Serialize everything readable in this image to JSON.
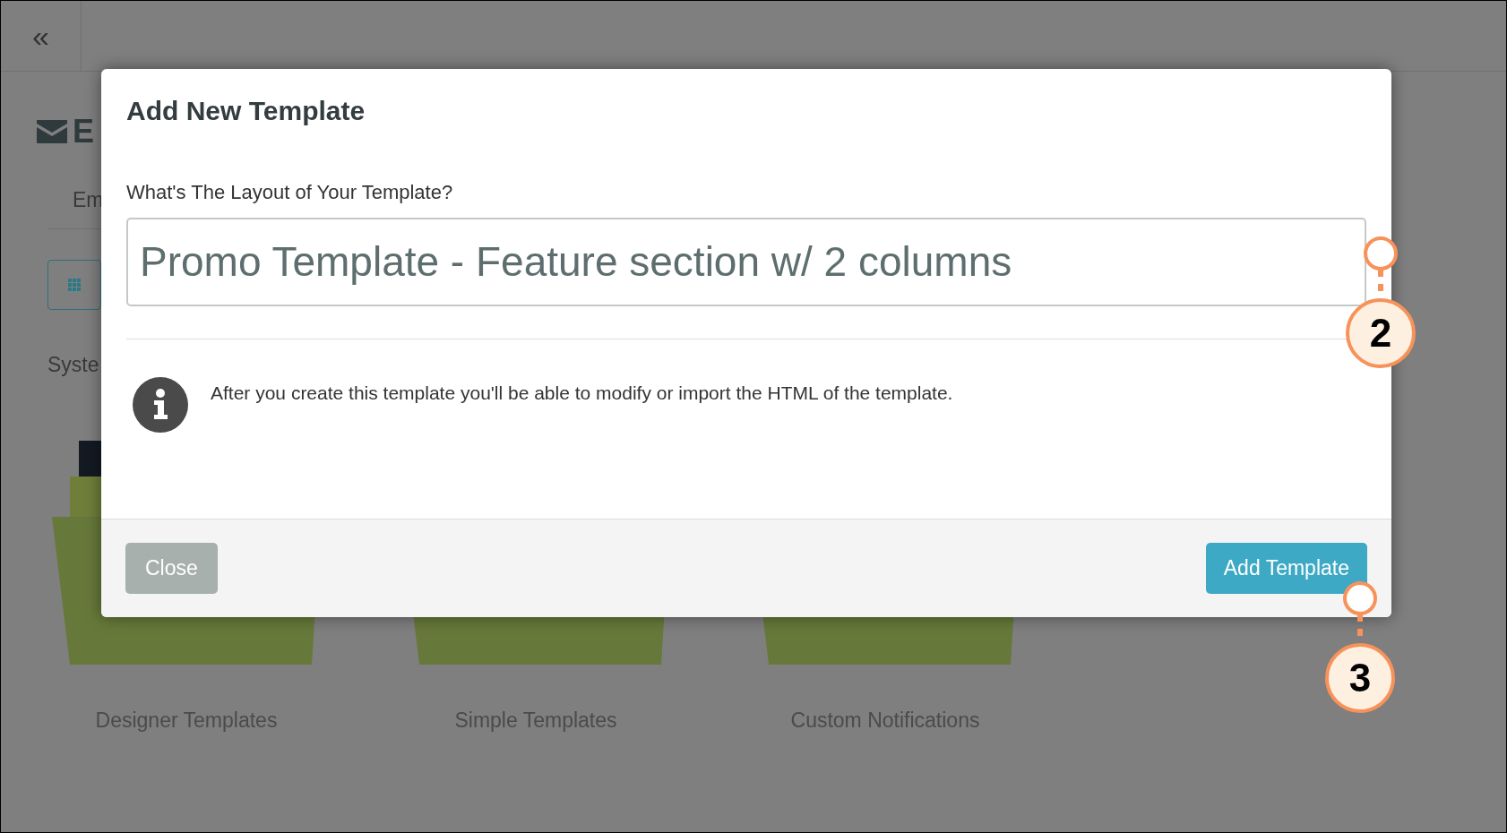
{
  "topbar": {
    "collapse_icon": "«"
  },
  "background": {
    "heading": "E",
    "tab": "Em",
    "section": "Syste",
    "folders": [
      {
        "label": "Designer Templates"
      },
      {
        "label": "Simple Templates"
      },
      {
        "label": "Custom Notifications"
      }
    ]
  },
  "modal": {
    "title": "Add New Template",
    "field_label": "What's The Layout of Your Template?",
    "field_value": "Promo Template - Feature section w/ 2 columns",
    "info": "After you create this template you'll be able to modify or import the HTML of the template.",
    "buttons": [
      {
        "label": "Close",
        "kind": "secondary"
      },
      {
        "label": "Add Template",
        "kind": "primary"
      }
    ]
  },
  "callouts": [
    {
      "number": "2"
    },
    {
      "number": "3"
    }
  ]
}
